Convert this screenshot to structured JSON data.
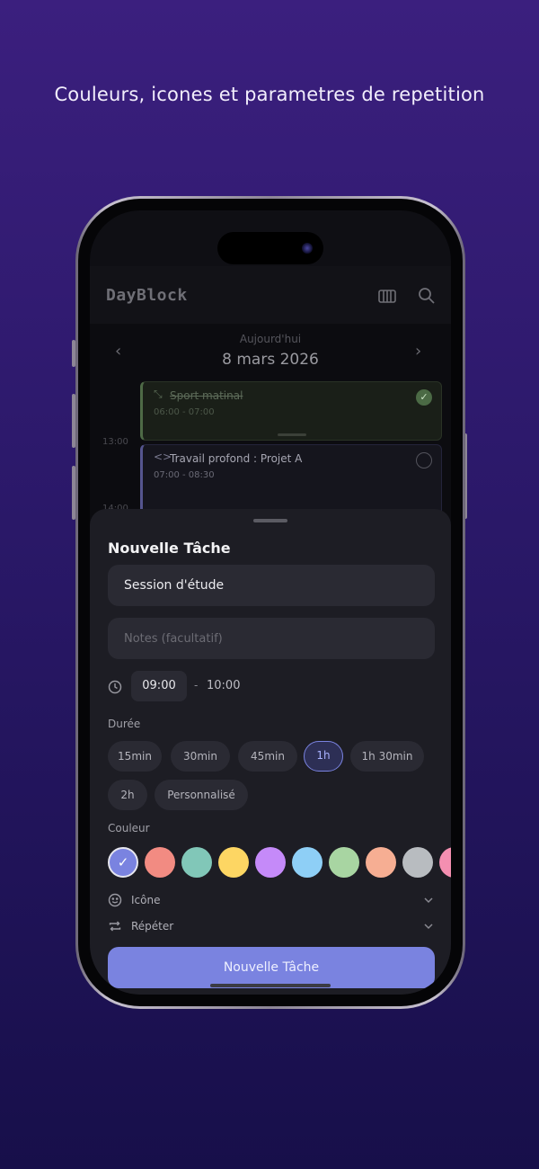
{
  "promo": {
    "headline": "Couleurs, icones et parametres de repetition"
  },
  "app": {
    "title": "DayBlock",
    "header_icons": [
      "calendar-grid-icon",
      "search-icon"
    ]
  },
  "date_nav": {
    "subtitle": "Aujourd'hui",
    "date": "8 mars 2026"
  },
  "timeline": {
    "time_labels": [
      "13:00",
      "14:00"
    ],
    "tasks": [
      {
        "title": "Sport matinal",
        "time": "06:00 - 07:00",
        "done": true,
        "icon": "expand-arrows-icon",
        "color": "#4e6a46"
      },
      {
        "title": "Travail profond : Projet A",
        "time": "07:00 - 08:30",
        "done": false,
        "icon": "code-icon",
        "color": "#55558e"
      }
    ]
  },
  "sheet": {
    "title": "Nouvelle Tâche",
    "task_name": "Session d'étude",
    "notes_placeholder": "Notes (facultatif)",
    "start_time": "09:00",
    "separator": "-",
    "end_time": "10:00",
    "duration_label": "Durée",
    "durations": [
      "15min",
      "30min",
      "45min",
      "1h",
      "1h 30min",
      "2h",
      "Personnalisé"
    ],
    "selected_duration": "1h",
    "color_label": "Couleur",
    "colors": [
      "#7a83e0",
      "#f28b82",
      "#81c7b8",
      "#fdd663",
      "#c58af9",
      "#8ecff6",
      "#a8d5a2",
      "#f6ae93",
      "#b8bcc0",
      "#f48fb1"
    ],
    "selected_color": "#7a83e0",
    "icon_label": "Icône",
    "repeat_label": "Répéter",
    "submit_label": "Nouvelle Tâche"
  }
}
